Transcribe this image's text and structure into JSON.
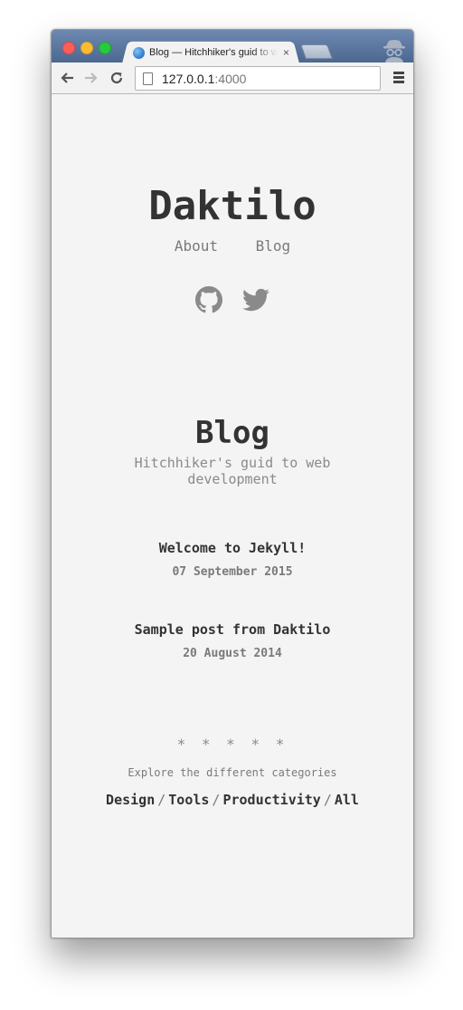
{
  "browser": {
    "tab_title": "Blog — Hitchhiker's guid to web development",
    "tab_close": "×",
    "url_host": "127.0.0.1",
    "url_port": ":4000"
  },
  "site": {
    "title": "Daktilo",
    "nav": [
      "About",
      "Blog"
    ],
    "social": [
      "github-icon",
      "twitter-icon"
    ]
  },
  "blog": {
    "title": "Blog",
    "subtitle": "Hitchhiker's guid to web development",
    "posts": [
      {
        "title": "Welcome to Jekyll!",
        "date": "07 September 2015"
      },
      {
        "title": "Sample post from Daktilo",
        "date": "20 August 2014"
      }
    ]
  },
  "footer": {
    "stars": "* * * * *",
    "explore": "Explore the different categories",
    "categories": [
      "Design",
      "Tools",
      "Productivity",
      "All"
    ],
    "separator": "/"
  },
  "colors": {
    "page_bg": "#f4f4f4",
    "title_text": "#333333",
    "muted_text": "#7a7a7a",
    "titlebar": "#5a769e"
  }
}
